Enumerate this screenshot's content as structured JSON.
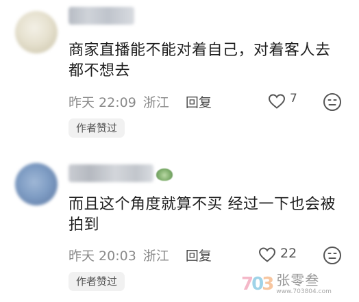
{
  "comments": [
    {
      "text": "商家直播能不能对着自己，对着客人去都不想去",
      "date": "昨天 22:09",
      "region": "浙江",
      "reply_label": "回复",
      "likes": "7",
      "author_tag": "作者赞过"
    },
    {
      "text": "而且这个角度就算不买 经过一下也会被拍到",
      "date": "昨天 20:03",
      "region": "浙江",
      "reply_label": "回复",
      "likes": "22",
      "author_tag": "作者赞过"
    }
  ],
  "watermark": {
    "logo": "703",
    "name": "张零叁",
    "url": "www.703804.com"
  },
  "colors": {
    "meta_gray": "#8a8a8a",
    "tag_bg": "#f1f1f1"
  },
  "icons": [
    "heart-outline-icon",
    "dislike-face-icon"
  ]
}
